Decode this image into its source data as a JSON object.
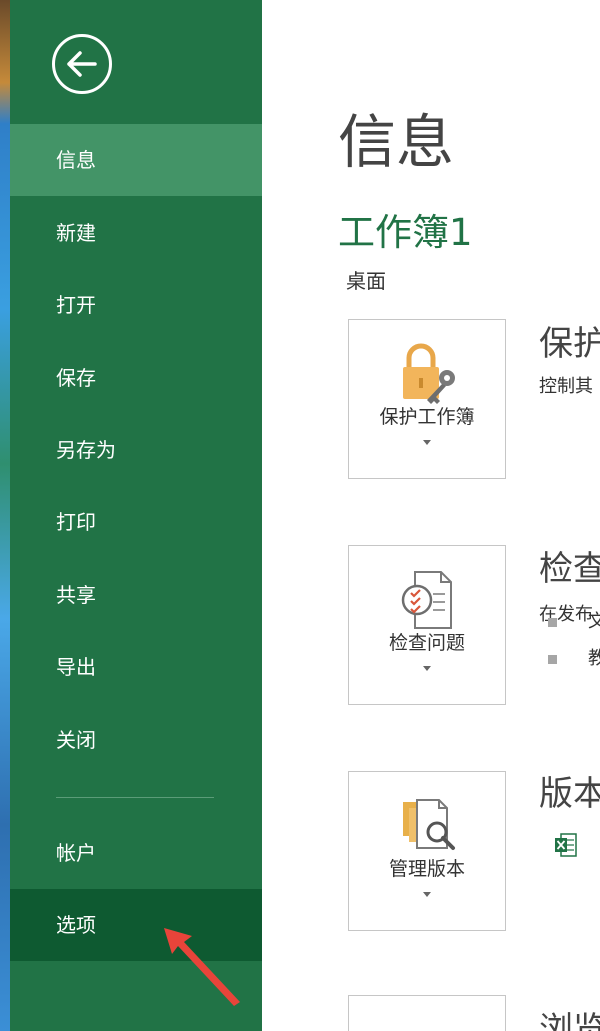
{
  "sidebar": {
    "items": [
      {
        "label": "信息"
      },
      {
        "label": "新建"
      },
      {
        "label": "打开"
      },
      {
        "label": "保存"
      },
      {
        "label": "另存为"
      },
      {
        "label": "打印"
      },
      {
        "label": "共享"
      },
      {
        "label": "导出"
      },
      {
        "label": "关闭"
      }
    ],
    "bottom_items": [
      {
        "label": "帐户"
      },
      {
        "label": "选项"
      }
    ],
    "selected": "信息",
    "highlighted": "选项"
  },
  "main": {
    "title": "信息",
    "workbook_name": "工作簿1",
    "workbook_location": "桌面",
    "sections": [
      {
        "tile_label": "保护工作簿",
        "title": "保护",
        "desc": "控制其",
        "bullets": []
      },
      {
        "tile_label": "检查问题",
        "title": "检查",
        "desc": "在发布",
        "bullets": [
          "文",
          "教"
        ]
      },
      {
        "tile_label": "管理版本",
        "title": "版本",
        "desc": "",
        "bullets": []
      }
    ],
    "partial_title": "浏览"
  },
  "colors": {
    "sidebar": "#217346",
    "sidebar_selected": "#439467",
    "sidebar_pressed": "#0e5a31",
    "accent": "#217346",
    "annotation_arrow": "#e8443a"
  }
}
